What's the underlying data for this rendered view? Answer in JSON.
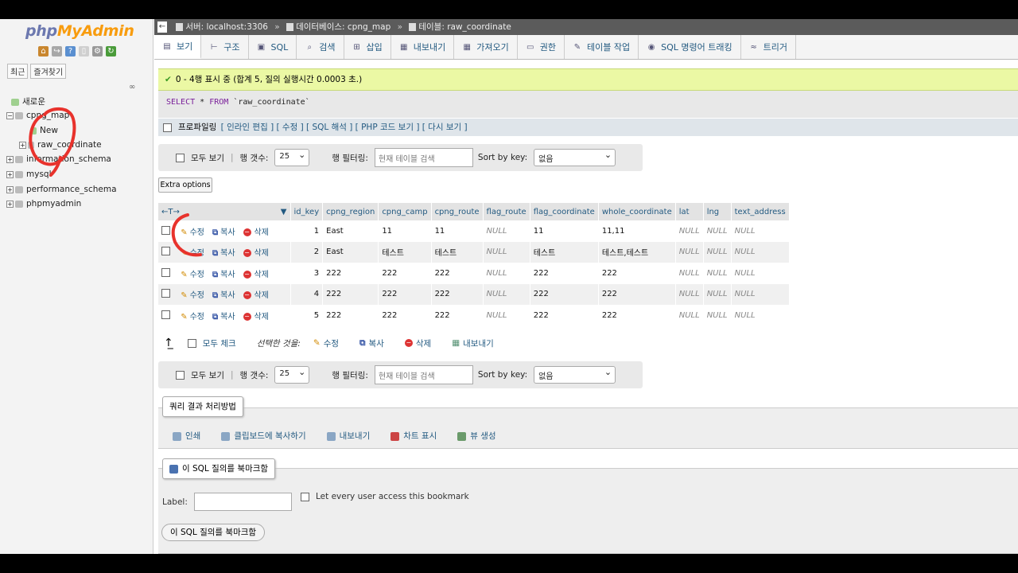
{
  "nav": {
    "logo_php": "php",
    "logo_my": "MyAdmin",
    "tab_recent": "최근",
    "tab_favorites": "즐겨찾기",
    "tree": [
      {
        "label": "새로운",
        "indent": 0
      },
      {
        "label": "cpng_map",
        "indent": 0
      },
      {
        "label": "New",
        "indent": 1
      },
      {
        "label": "raw_coordinate",
        "indent": 1
      },
      {
        "label": "information_schema",
        "indent": 0
      },
      {
        "label": "mysql",
        "indent": 0
      },
      {
        "label": "performance_schema",
        "indent": 0
      },
      {
        "label": "phpmyadmin",
        "indent": 0
      }
    ]
  },
  "breadcrumb": {
    "server": "서버: localhost:3306",
    "database": "데이터베이스: cpng_map",
    "table": "테이블: raw_coordinate"
  },
  "tabs": [
    "보기",
    "구조",
    "SQL",
    "검색",
    "삽입",
    "내보내기",
    "가져오기",
    "권한",
    "테이블 작업",
    "SQL 명령어 트래킹",
    "트리거"
  ],
  "success_message": "0 - 4행 표시 중 (합계 5, 질의 실행시간 0.0003 초.)",
  "sql": {
    "select": "SELECT",
    "star": "*",
    "from": "FROM",
    "table": "`raw_coordinate`"
  },
  "profiling": {
    "label": "프로파일링",
    "links": "[ 인라인 편집 ] [ 수정 ] [ SQL 해석 ] [ PHP 코드 보기 ] [ 다시 보기 ]"
  },
  "navbar": {
    "show_all": "모두 보기",
    "rows_label": "행 갯수:",
    "rows_value": "25",
    "filter_label": "행 필터링:",
    "filter_placeholder": "현재 테이블 검색",
    "sort_label": "Sort by key:",
    "sort_value": "없음"
  },
  "extra_options": "Extra options",
  "table": {
    "columns": [
      "id_key",
      "cpng_region",
      "cpng_camp",
      "cpng_route",
      "flag_route",
      "flag_coordinate",
      "whole_coordinate",
      "lat",
      "lng",
      "text_address"
    ],
    "row_actions": {
      "edit": "수정",
      "copy": "복사",
      "delete": "삭제"
    },
    "rows": [
      [
        "1",
        "East",
        "11",
        "11",
        "NULL",
        "11",
        "11,11",
        "NULL",
        "NULL",
        "NULL"
      ],
      [
        "2",
        "East",
        "테스트",
        "테스트",
        "NULL",
        "테스트",
        "테스트,테스트",
        "NULL",
        "NULL",
        "NULL"
      ],
      [
        "3",
        "222",
        "222",
        "222",
        "NULL",
        "222",
        "222",
        "NULL",
        "NULL",
        "NULL"
      ],
      [
        "4",
        "222",
        "222",
        "222",
        "NULL",
        "222",
        "222",
        "NULL",
        "NULL",
        "NULL"
      ],
      [
        "5",
        "222",
        "222",
        "222",
        "NULL",
        "222",
        "222",
        "NULL",
        "NULL",
        "NULL"
      ]
    ]
  },
  "bulk": {
    "check_all": "모두 체크",
    "with_selected": "선택한 것을:",
    "edit": "수정",
    "copy": "복사",
    "delete": "삭제",
    "export": "내보내기"
  },
  "query_ops": {
    "legend": "쿼리 결과 처리방법",
    "print": "인쇄",
    "clipboard": "클립보드에 복사하기",
    "export": "내보내기",
    "chart": "차트 표시",
    "view": "뷰 생성"
  },
  "bookmark": {
    "legend": "이 SQL 질의를 북마크함",
    "label": "Label:",
    "everyone": "Let every user access this bookmark",
    "button": "이 SQL 질의를 북마크함"
  },
  "colors": {
    "link": "#235a81",
    "success_bg": "#ebf8a4",
    "annotation": "#e8322c"
  }
}
